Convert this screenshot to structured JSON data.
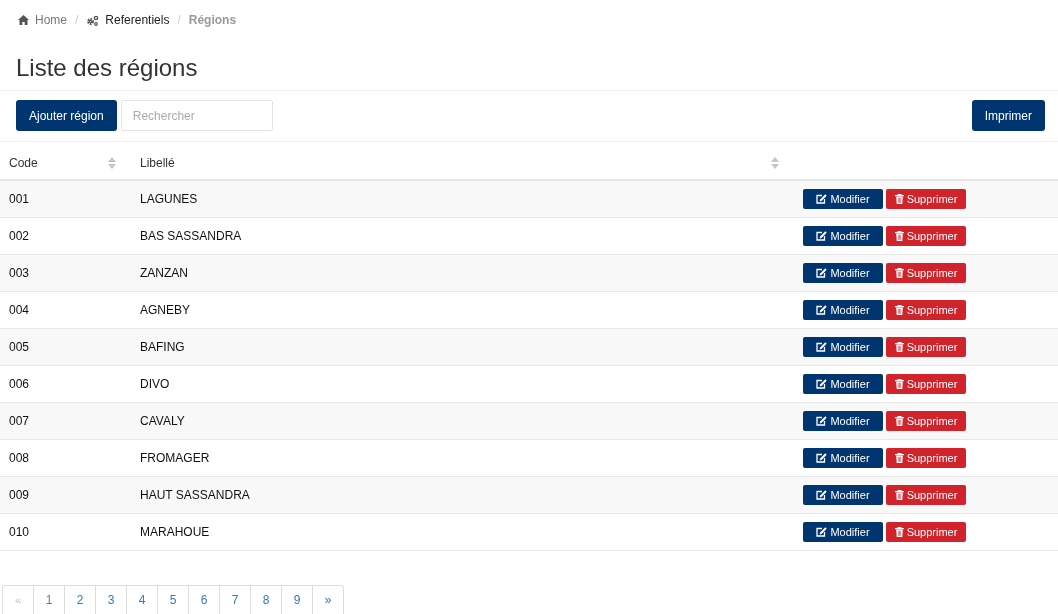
{
  "breadcrumb": [
    {
      "kind": "home",
      "label": "Home",
      "separator": "/"
    },
    {
      "kind": "link",
      "label": "Referentiels",
      "separator": "/"
    },
    {
      "kind": "current",
      "label": "Régions"
    }
  ],
  "page_title": "Liste des régions",
  "toolbar": {
    "add_button": "Ajouter région",
    "search": {
      "placeholder": "Rechercher"
    },
    "print_button": "Imprimer"
  },
  "table": {
    "columns": [
      {
        "label": "Code",
        "sortable": true
      },
      {
        "label": "Libellé",
        "sortable": true
      }
    ],
    "rows": [
      {
        "code": "001",
        "label": "LAGUNES",
        "actions": [
          {
            "kind": "edit",
            "label": "Modifier"
          },
          {
            "kind": "delete",
            "label": "Supprimer"
          }
        ]
      },
      {
        "code": "002",
        "label": "BAS SASSANDRA",
        "actions": [
          {
            "kind": "edit",
            "label": "Modifier"
          },
          {
            "kind": "delete",
            "label": "Supprimer"
          }
        ]
      },
      {
        "code": "003",
        "label": "ZANZAN",
        "actions": [
          {
            "kind": "edit",
            "label": "Modifier"
          },
          {
            "kind": "delete",
            "label": "Supprimer"
          }
        ]
      },
      {
        "code": "004",
        "label": "AGNEBY",
        "actions": [
          {
            "kind": "edit",
            "label": "Modifier"
          },
          {
            "kind": "delete",
            "label": "Supprimer"
          }
        ]
      },
      {
        "code": "005",
        "label": "BAFING",
        "actions": [
          {
            "kind": "edit",
            "label": "Modifier"
          },
          {
            "kind": "delete",
            "label": "Supprimer"
          }
        ]
      },
      {
        "code": "006",
        "label": "DIVO",
        "actions": [
          {
            "kind": "edit",
            "label": "Modifier"
          },
          {
            "kind": "delete",
            "label": "Supprimer"
          }
        ]
      },
      {
        "code": "007",
        "label": "CAVALY",
        "actions": [
          {
            "kind": "edit",
            "label": "Modifier"
          },
          {
            "kind": "delete",
            "label": "Supprimer"
          }
        ]
      },
      {
        "code": "008",
        "label": "FROMAGER",
        "actions": [
          {
            "kind": "edit",
            "label": "Modifier"
          },
          {
            "kind": "delete",
            "label": "Supprimer"
          }
        ]
      },
      {
        "code": "009",
        "label": "HAUT SASSANDRA",
        "actions": [
          {
            "kind": "edit",
            "label": "Modifier"
          },
          {
            "kind": "delete",
            "label": "Supprimer"
          }
        ]
      },
      {
        "code": "010",
        "label": "MARAHOUE",
        "actions": [
          {
            "kind": "edit",
            "label": "Modifier"
          },
          {
            "kind": "delete",
            "label": "Supprimer"
          }
        ]
      }
    ]
  },
  "pagination": [
    {
      "label": "«",
      "selected": false,
      "disabled": true
    },
    {
      "label": "1",
      "selected": true,
      "disabled": false
    },
    {
      "label": "2",
      "selected": false,
      "disabled": false
    },
    {
      "label": "3",
      "selected": false,
      "disabled": false
    },
    {
      "label": "4",
      "selected": false,
      "disabled": false
    },
    {
      "label": "5",
      "selected": false,
      "disabled": false
    },
    {
      "label": "6",
      "selected": false,
      "disabled": false
    },
    {
      "label": "7",
      "selected": false,
      "disabled": false
    },
    {
      "label": "8",
      "selected": false,
      "disabled": false
    },
    {
      "label": "9",
      "selected": false,
      "disabled": false
    },
    {
      "label": "»",
      "selected": false,
      "disabled": false
    }
  ]
}
